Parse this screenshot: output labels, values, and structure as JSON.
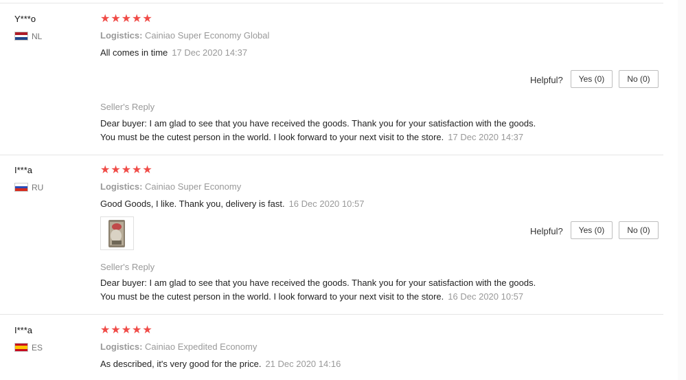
{
  "helpful_label": "Helpful?",
  "reply_title": "Seller's Reply",
  "star_color": "#f04b47",
  "reviews": [
    {
      "user": "Y***o",
      "country": "NL",
      "flag_icon": "netherlands-flag-icon",
      "rating": 5,
      "stars": "★★★★★",
      "logistics_label": "Logistics:",
      "logistics": "Cainiao Super Economy Global",
      "feedback": "All comes in time",
      "date": "17 Dec 2020 14:37",
      "yes": "Yes (0)",
      "no": "No (0)",
      "reply_line1": "Dear buyer: I am glad to see that you have received the goods. Thank you for your satisfaction with the goods.",
      "reply_line2": "You must be the cutest person in the world. I look forward to your next visit to the store.",
      "reply_date": "17 Dec 2020 14:37"
    },
    {
      "user": "I***a",
      "country": "RU",
      "flag_icon": "russia-flag-icon",
      "rating": 5,
      "stars": "★★★★★",
      "logistics_label": "Logistics:",
      "logistics": "Cainiao Super Economy",
      "feedback": "Good Goods, I like. Thank you, delivery is fast.",
      "date": "16 Dec 2020 10:57",
      "yes": "Yes (0)",
      "no": "No (0)",
      "reply_line1": "Dear buyer: I am glad to see that you have received the goods. Thank you for your satisfaction with the goods.",
      "reply_line2": "You must be the cutest person in the world. I look forward to your next visit to the store.",
      "reply_date": "16 Dec 2020 10:57"
    },
    {
      "user": "I***a",
      "country": "ES",
      "flag_icon": "spain-flag-icon",
      "rating": 5,
      "stars": "★★★★★",
      "logistics_label": "Logistics:",
      "logistics": "Cainiao Expedited Economy",
      "feedback": "As described, it's very good for the price.",
      "date": "21 Dec 2020 14:16"
    }
  ]
}
